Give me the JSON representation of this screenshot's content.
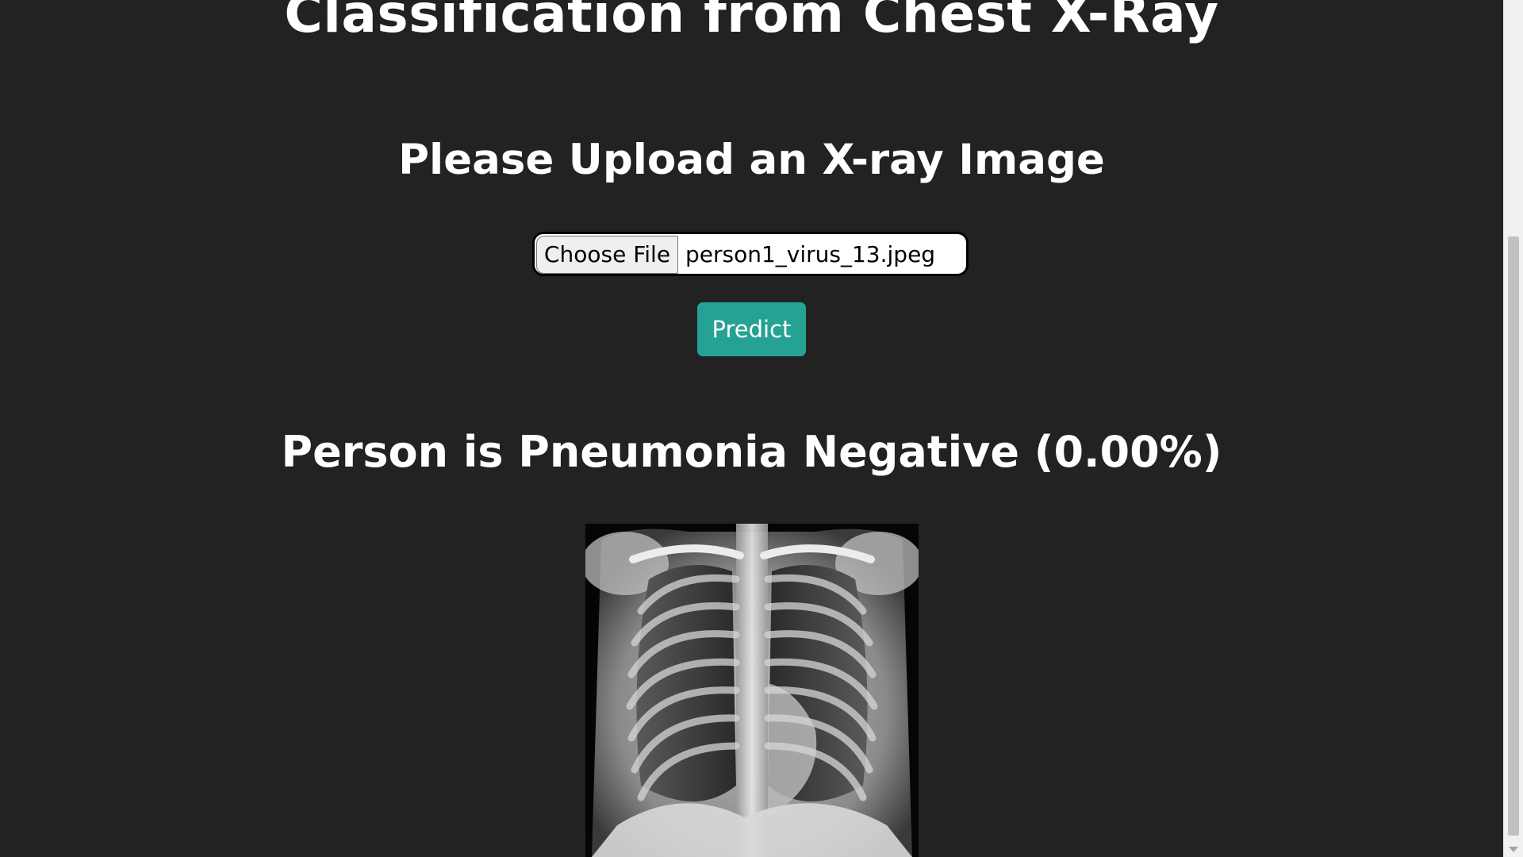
{
  "page": {
    "title": "Classification from Chest X-Ray",
    "upload_heading": "Please Upload an X-ray Image"
  },
  "file_input": {
    "button_label": "Choose File",
    "file_name": "person1_virus_13.jpeg"
  },
  "predict": {
    "label": "Predict"
  },
  "result": {
    "text": "Person is Pneumonia Negative (0.00%)"
  },
  "colors": {
    "background": "#222222",
    "text": "#ffffff",
    "accent": "#26a294"
  },
  "icons": {
    "scroll_down": "chevron-down-icon"
  }
}
